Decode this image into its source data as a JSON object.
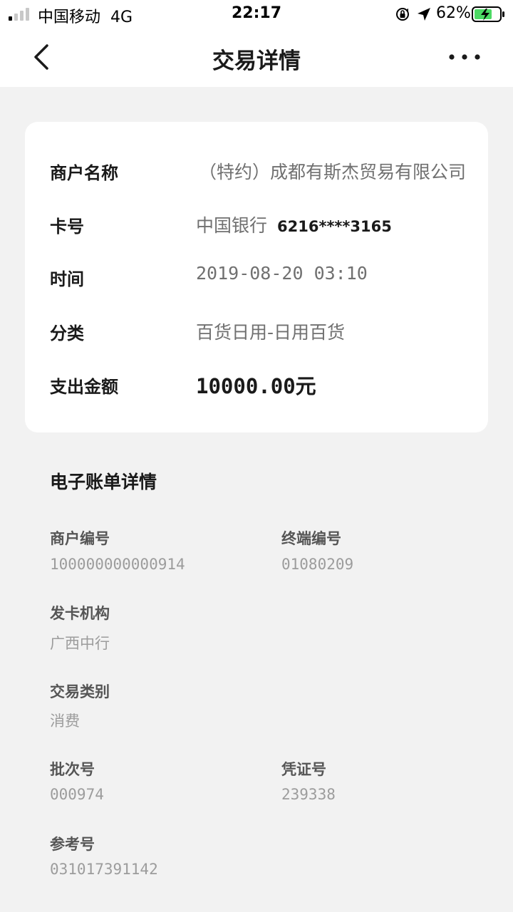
{
  "status_bar": {
    "carrier": "中国移动",
    "network": "4G",
    "time": "22:17",
    "battery": "62%",
    "signal_bars_active": 1,
    "signal_bars_total": 4
  },
  "nav": {
    "title": "交易详情",
    "back_icon": "chevron-left-icon",
    "more_icon": "more-dots-icon"
  },
  "summary": {
    "merchant_label": "商户名称",
    "merchant_value": "（特约）成都有斯杰贸易有限公司",
    "card_label": "卡号",
    "card_bank": "中国银行",
    "card_number": "6216****3165",
    "time_label": "时间",
    "time_value": "2019-08-20 03:10",
    "category_label": "分类",
    "category_value": "百货日用-日用百货",
    "amount_label": "支出金额",
    "amount_value": "10000.00元"
  },
  "ebill": {
    "title": "电子账单详情",
    "merchant_no_label": "商户编号",
    "merchant_no_value": "100000000000914",
    "terminal_no_label": "终端编号",
    "terminal_no_value": "01080209",
    "issuer_label": "发卡机构",
    "issuer_value": "广西中行",
    "txn_type_label": "交易类别",
    "txn_type_value": "消费",
    "batch_no_label": "批次号",
    "batch_no_value": "000974",
    "voucher_no_label": "凭证号",
    "voucher_no_value": "239338",
    "ref_no_label": "参考号",
    "ref_no_value": "031017391142"
  },
  "colors": {
    "background": "#f2f2f2",
    "card": "#ffffff",
    "battery_charge": "#4cd964"
  }
}
